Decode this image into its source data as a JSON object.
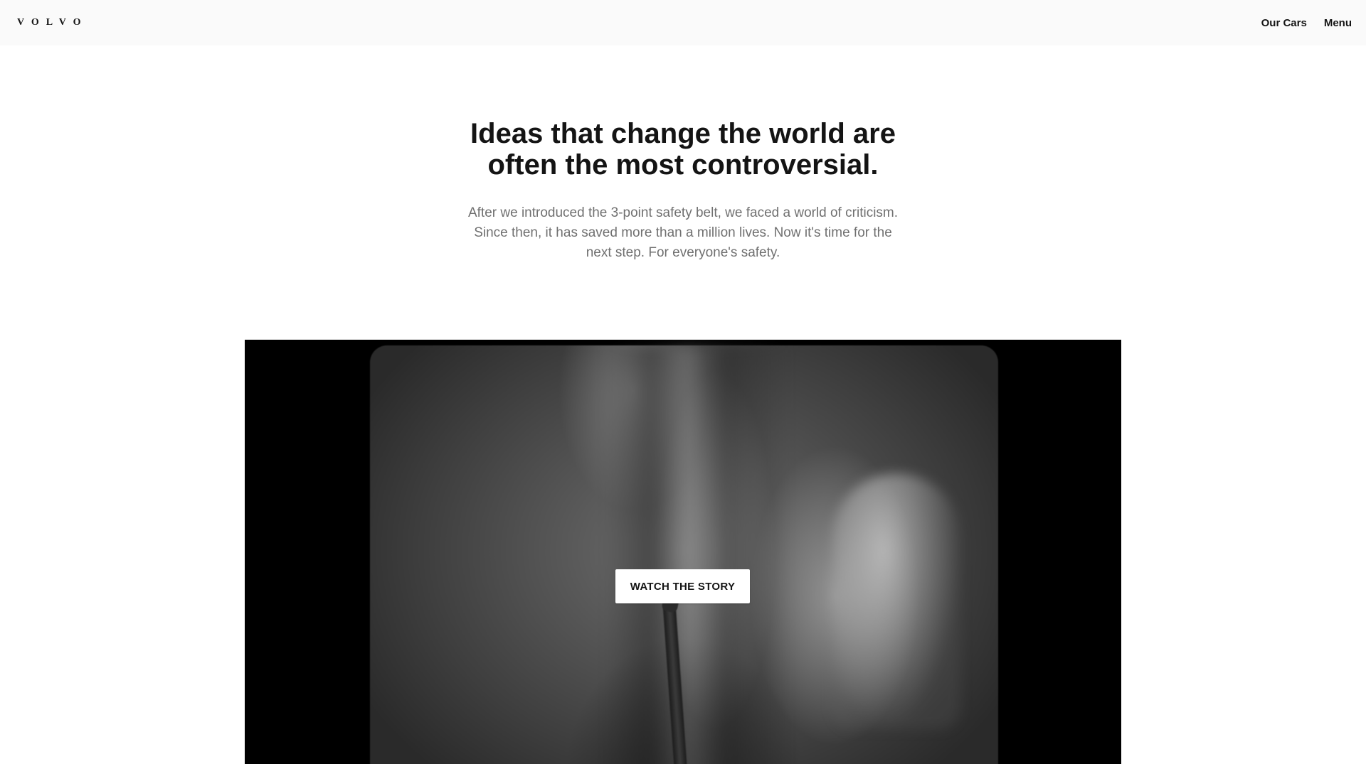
{
  "header": {
    "logo_text": "VOLVO",
    "nav": {
      "our_cars": "Our Cars",
      "menu": "Menu"
    }
  },
  "intro": {
    "headline": "Ideas that change the world are often the most controversial.",
    "body": "After we introduced the 3-point safety belt, we faced a world of criticism. Since then, it has saved more than a million lives. Now it's time for the next step. For everyone's safety."
  },
  "video": {
    "cta_label": "WATCH THE STORY"
  }
}
